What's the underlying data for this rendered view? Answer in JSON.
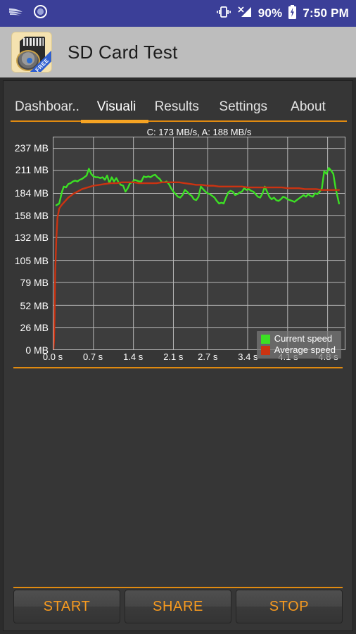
{
  "statusbar": {
    "left_icons": [
      "keyboard-swoosh-icon",
      "circle-dot-icon"
    ],
    "vibrate_icon": "vibrate-icon",
    "signal_icon": "no-signal-icon",
    "battery_percent": "90%",
    "battery_icon": "battery-charging-icon",
    "time": "7:50 PM",
    "bg_color": "#3b3f98"
  },
  "actionbar": {
    "app_icon": "sd-card-speedometer-icon",
    "ribbon_label": "FREE",
    "title": "SD Card Test",
    "bg_color": "#bdbdbd"
  },
  "tabs": {
    "items": [
      {
        "label": "Dashboar..",
        "active": false
      },
      {
        "label": "Visuali",
        "active": true
      },
      {
        "label": "Results",
        "active": false
      },
      {
        "label": "Settings",
        "active": false
      },
      {
        "label": "About",
        "active": false
      }
    ],
    "indicator_color": "#f7a423",
    "rule_color": "#e08a10"
  },
  "chart_data": {
    "type": "line",
    "title": "C: 173 MB/s, A: 188 MB/s",
    "xlabel": "",
    "ylabel": "",
    "grid": true,
    "legend_position": "bottom-right",
    "ylim": [
      0,
      250
    ],
    "xlim": [
      0,
      5.1
    ],
    "ytick_labels": [
      "237 MB",
      "211 MB",
      "184 MB",
      "158 MB",
      "132 MB",
      "105 MB",
      "79 MB",
      "52 MB",
      "26 MB",
      "0 MB"
    ],
    "ytick_values": [
      237,
      211,
      184,
      158,
      132,
      105,
      79,
      52,
      26,
      0
    ],
    "xtick_labels": [
      "0.0 s",
      "0.7 s",
      "1.4 s",
      "2.1 s",
      "2.7 s",
      "3.4 s",
      "4.1 s",
      "4.8 s"
    ],
    "xtick_values": [
      0.0,
      0.7,
      1.4,
      2.1,
      2.7,
      3.4,
      4.1,
      4.8
    ],
    "series": [
      {
        "name": "Current speed",
        "color": "#3ce024",
        "x": [
          0.05,
          0.1,
          0.15,
          0.18,
          0.22,
          0.26,
          0.3,
          0.34,
          0.38,
          0.42,
          0.46,
          0.5,
          0.54,
          0.58,
          0.62,
          0.66,
          0.7,
          0.74,
          0.78,
          0.82,
          0.86,
          0.9,
          0.94,
          0.98,
          1.02,
          1.06,
          1.1,
          1.14,
          1.18,
          1.22,
          1.26,
          1.3,
          1.34,
          1.38,
          1.42,
          1.46,
          1.5,
          1.54,
          1.58,
          1.62,
          1.66,
          1.7,
          1.74,
          1.78,
          1.82,
          1.86,
          1.9,
          1.94,
          1.98,
          2.02,
          2.06,
          2.1,
          2.14,
          2.18,
          2.22,
          2.26,
          2.3,
          2.34,
          2.38,
          2.42,
          2.46,
          2.5,
          2.54,
          2.58,
          2.62,
          2.66,
          2.7,
          2.74,
          2.78,
          2.82,
          2.86,
          2.9,
          2.94,
          2.98,
          3.02,
          3.06,
          3.1,
          3.14,
          3.18,
          3.22,
          3.26,
          3.3,
          3.34,
          3.38,
          3.42,
          3.46,
          3.5,
          3.54,
          3.58,
          3.62,
          3.66,
          3.7,
          3.74,
          3.78,
          3.82,
          3.86,
          3.9,
          3.94,
          3.98,
          4.02,
          4.06,
          4.1,
          4.14,
          4.18,
          4.22,
          4.26,
          4.3,
          4.34,
          4.38,
          4.42,
          4.46,
          4.5,
          4.54,
          4.58,
          4.62,
          4.66,
          4.7,
          4.74,
          4.78,
          4.82,
          4.86,
          4.9,
          4.94,
          4.98,
          5.0
        ],
        "y": [
          170,
          172,
          186,
          192,
          191,
          195,
          196,
          198,
          199,
          198,
          200,
          201,
          203,
          205,
          213,
          207,
          204,
          203,
          203,
          202,
          203,
          200,
          205,
          196,
          203,
          198,
          202,
          197,
          194,
          193,
          186,
          190,
          196,
          197,
          200,
          199,
          198,
          198,
          204,
          203,
          204,
          203,
          205,
          206,
          203,
          201,
          197,
          197,
          198,
          195,
          190,
          186,
          183,
          180,
          179,
          182,
          188,
          186,
          183,
          181,
          177,
          176,
          180,
          192,
          189,
          186,
          184,
          183,
          181,
          179,
          175,
          172,
          173,
          172,
          179,
          185,
          187,
          186,
          182,
          183,
          185,
          186,
          190,
          188,
          189,
          187,
          186,
          183,
          180,
          179,
          184,
          192,
          186,
          180,
          177,
          179,
          176,
          175,
          177,
          180,
          179,
          177,
          176,
          175,
          174,
          176,
          178,
          180,
          182,
          180,
          183,
          181,
          180,
          184,
          183,
          186,
          190,
          210,
          207,
          214,
          211,
          207,
          190,
          178,
          172
        ]
      },
      {
        "name": "Average speed",
        "color": "#cc3311",
        "x": [
          0.0,
          0.01,
          0.02,
          0.03,
          0.05,
          0.07,
          0.1,
          0.14,
          0.18,
          0.22,
          0.26,
          0.3,
          0.36,
          0.42,
          0.5,
          0.6,
          0.7,
          0.8,
          0.9,
          1.0,
          1.1,
          1.2,
          1.3,
          1.4,
          1.5,
          1.6,
          1.7,
          1.8,
          1.9,
          2.0,
          2.1,
          2.2,
          2.3,
          2.4,
          2.5,
          2.6,
          2.7,
          2.8,
          2.9,
          3.0,
          3.1,
          3.2,
          3.3,
          3.4,
          3.5,
          3.6,
          3.7,
          3.8,
          3.9,
          4.0,
          4.1,
          4.2,
          4.3,
          4.4,
          4.5,
          4.6,
          4.7,
          4.8,
          4.9,
          5.0
        ],
        "y": [
          0,
          10,
          40,
          90,
          130,
          155,
          166,
          170,
          173,
          176,
          179,
          181,
          184,
          186,
          189,
          191,
          193,
          194,
          195,
          196,
          196,
          197,
          197,
          197,
          196,
          196,
          196,
          196,
          197,
          197,
          197,
          197,
          196,
          195,
          194,
          194,
          193,
          193,
          192,
          192,
          192,
          192,
          192,
          191,
          191,
          191,
          191,
          191,
          191,
          191,
          190,
          190,
          190,
          189,
          189,
          189,
          188,
          188,
          188,
          188
        ]
      }
    ],
    "legend": [
      {
        "label": "Current speed",
        "color": "#3ce024"
      },
      {
        "label": "Average speed",
        "color": "#cc3311"
      }
    ]
  },
  "buttons": {
    "start": "START",
    "share": "SHARE",
    "stop": "STOP",
    "text_color": "#f79a1f"
  }
}
